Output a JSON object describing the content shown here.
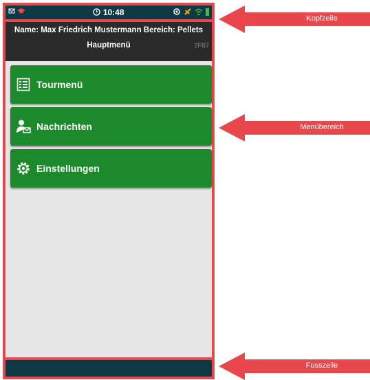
{
  "statusbar": {
    "time": "10:48"
  },
  "header": {
    "name_line": "Name: Max Friedrich Mustermann Bereich: Pellets",
    "title": "Hauptmenü",
    "code": "2FB7"
  },
  "menu": {
    "items": [
      {
        "label": "Tourmenü",
        "icon": "list-icon"
      },
      {
        "label": "Nachrichten",
        "icon": "user-message-icon"
      },
      {
        "label": "Einstellungen",
        "icon": "gear-icon"
      }
    ]
  },
  "callouts": {
    "kopfzeile": "Kopfzeile",
    "menuebereich": "Menübereich",
    "fusszeile": "Fusszeile"
  },
  "colors": {
    "annotation_red": "#e8484c",
    "status_bar": "#0d3a45",
    "menu_green": "#1c8a2a",
    "header_dark": "#2b2b2b"
  }
}
